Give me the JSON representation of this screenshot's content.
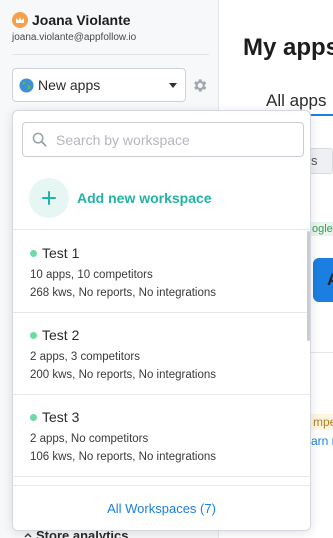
{
  "user": {
    "name": "Joana Violante",
    "email": "joana.violante@appfollow.io"
  },
  "workspace_select": {
    "value": "New apps",
    "icon": "globe-icon"
  },
  "sidebar": {
    "store_analytics_label": "Store analytics"
  },
  "main": {
    "title": "My apps",
    "tab": "All apps",
    "filter_fragment": "s",
    "badge_fragment": "ogle",
    "app_initial": "A",
    "compete_fragment": "mpe",
    "learn_fragment": "arn m"
  },
  "dropdown": {
    "search": {
      "placeholder": "Search by workspace",
      "value": ""
    },
    "add_label": "Add new workspace",
    "workspaces": [
      {
        "name": "Test 1",
        "apps_line": "10 apps, 10 competitors",
        "info_line": "268 kws, No reports, No integrations",
        "status": "active"
      },
      {
        "name": "Test 2",
        "apps_line": "2 apps, 3 competitors",
        "info_line": "200 kws, No reports, No integrations",
        "status": "active"
      },
      {
        "name": "Test 3",
        "apps_line": "2 apps, No competitors",
        "info_line": "106 kws, No reports, No integrations",
        "status": "active"
      }
    ],
    "footer_link": "All Workspaces (7)"
  },
  "colors": {
    "accent": "#21b3a5",
    "link": "#1a7fe0",
    "status_active": "#6fd9a3",
    "crown": "#f6a04d"
  }
}
